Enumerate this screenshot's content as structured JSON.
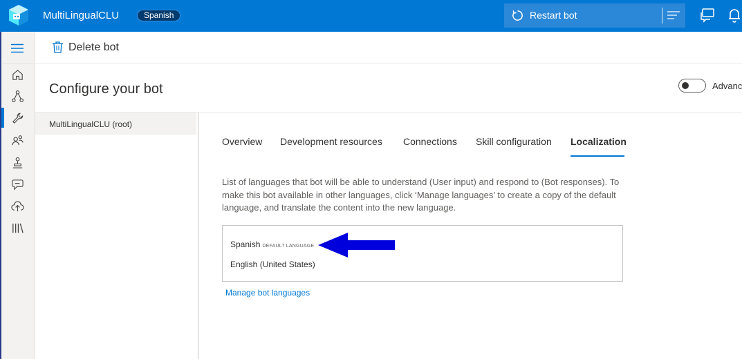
{
  "header": {
    "app_title": "MultiLingualCLU",
    "language_badge": "Spanish",
    "restart_label": "Restart bot",
    "brand_color": "#0078d4",
    "icons": [
      "bot-logo-icon",
      "restart-icon",
      "menu-lines-icon",
      "chat-icon",
      "bell-icon"
    ]
  },
  "leftnav": {
    "active_item": "configure",
    "items": [
      "hamburger-icon",
      "home-icon",
      "design-icon",
      "configure-icon",
      "users-icon",
      "test-icon",
      "chat-bubble-icon",
      "publish-icon",
      "library-icon"
    ]
  },
  "commandbar": {
    "delete_label": "Delete bot"
  },
  "page": {
    "title": "Configure your bot",
    "advanced_toggle_label": "Advance",
    "advanced_toggle_on": false
  },
  "bots": [
    {
      "label": "MultiLingualCLU (root)",
      "selected": true
    }
  ],
  "tabs": [
    {
      "label": "Overview",
      "selected": false
    },
    {
      "label": "Development resources",
      "selected": false
    },
    {
      "label": "Connections",
      "selected": false
    },
    {
      "label": "Skill configuration",
      "selected": false
    },
    {
      "label": "Localization",
      "selected": true
    }
  ],
  "localization": {
    "description": "List of languages that bot will be able to understand (User input) and respond to (Bot responses). To make this bot available in other languages, click ‘Manage languages’ to create a copy of the default language, and translate the content into the new language.",
    "languages": [
      {
        "name": "Spanish",
        "tag": "DEFAULT LANGUAGE"
      },
      {
        "name": "English (United States)",
        "tag": ""
      }
    ],
    "manage_link": "Manage bot languages",
    "annotation_arrow_color": "#0000dd"
  }
}
